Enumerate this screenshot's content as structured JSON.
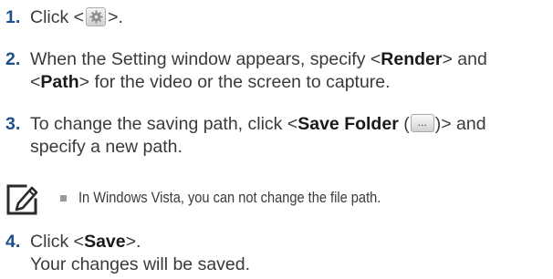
{
  "steps": [
    {
      "number": "1.",
      "prefix": "Click <",
      "icon": "gear-icon",
      "suffix": ">."
    },
    {
      "number": "2.",
      "text_a": "When the Setting window appears, specify <",
      "bold_a": "Render",
      "text_b": "> and",
      "text_c": "<",
      "bold_b": "Path",
      "text_d": "> for the video or the screen to capture."
    },
    {
      "number": "3.",
      "text_a": "To change the saving path, click <",
      "bold_a": "Save Folder",
      "text_b": " (",
      "button_label": "...",
      "text_c": ")> and",
      "text_d": "specify a new path."
    },
    {
      "number": "4.",
      "text_a": "Click <",
      "bold_a": "Save",
      "text_b": ">.",
      "text_c": "Your changes will be saved."
    }
  ],
  "note": {
    "icon": "note-pencil-icon",
    "text": "In Windows Vista, you can not change the file path."
  }
}
